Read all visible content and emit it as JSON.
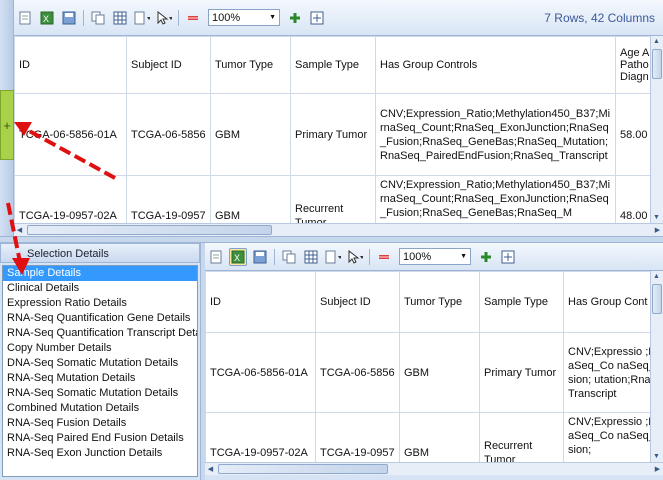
{
  "top": {
    "zoom": "100%",
    "summary": "7 Rows, 42 Columns",
    "columns": [
      "ID",
      "Subject ID",
      "Tumor Type",
      "Sample Type",
      "Has Group Controls",
      "Age A Patho Diagn"
    ],
    "rows": [
      [
        "TCGA-06-5856-01A",
        "TCGA-06-5856",
        "GBM",
        "Primary Tumor",
        "CNV;Expression_Ratio;Methylation450_B37;MirnaSeq_Count;RnaSeq_ExonJunction;RnaSeq_Fusion;RnaSeq_GeneBas;RnaSeq_Mutation;RnaSeq_PairedEndFusion;RnaSeq_Transcript",
        "58.00"
      ],
      [
        "TCGA-19-0957-02A",
        "TCGA-19-0957",
        "GBM",
        "Recurrent Tumor",
        "CNV;Expression_Ratio;Methylation450_B37;MirnaSeq_Count;RnaSeq_ExonJunction;RnaSeq_Fusion;RnaSeq_GeneBas;RnaSeq_M",
        "48.00"
      ]
    ]
  },
  "selection": {
    "header": "Selection Details",
    "items": [
      "Sample Details",
      "Clinical Details",
      "Expression Ratio Details",
      "RNA-Seq Quantification Gene Details",
      "RNA-Seq Quantification Transcript Deta",
      "Copy Number Details",
      "DNA-Seq Somatic Mutation Details",
      "RNA-Seq Mutation Details",
      "RNA-Seq Somatic Mutation Details",
      "Combined Mutation Details",
      "RNA-Seq Fusion Details",
      "RNA-Seq Paired End Fusion Details",
      "RNA-Seq Exon Junction Details"
    ]
  },
  "bottom": {
    "zoom": "100%",
    "columns": [
      "ID",
      "Subject ID",
      "Tumor Type",
      "Sample Type",
      "Has Group Cont"
    ],
    "rows": [
      [
        "TCGA-06-5856-01A",
        "TCGA-06-5856",
        "GBM",
        "Primary Tumor",
        "CNV;Expressio ;MirnaSeq_Co naSeq_Fusion; utation;RnaSeq Transcript"
      ],
      [
        "TCGA-19-0957-02A",
        "TCGA-19-0957",
        "GBM",
        "Recurrent Tumor",
        "CNV;Expressio ;MirnaSeq_Co naSeq_Fusion;"
      ]
    ]
  },
  "splitter_handle": "+"
}
